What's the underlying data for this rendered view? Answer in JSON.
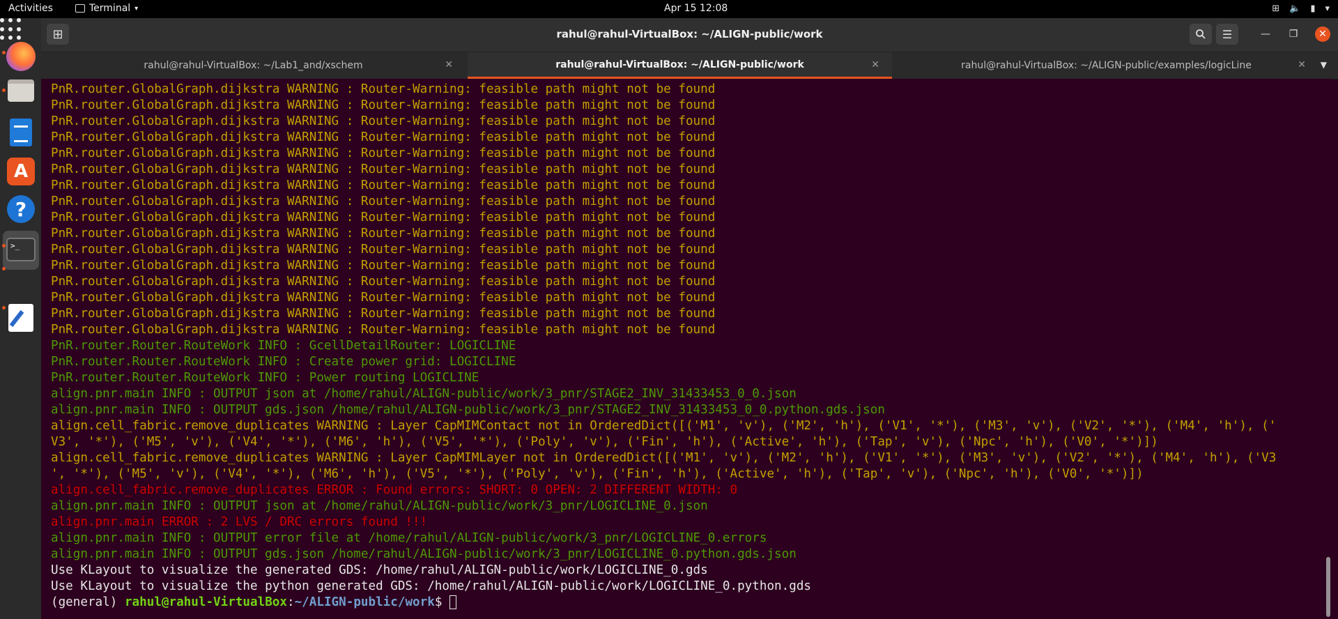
{
  "topbar": {
    "activities": "Activities",
    "app_name": "Terminal",
    "clock": "Apr 15  12:08"
  },
  "window": {
    "title": "rahul@rahul-VirtualBox: ~/ALIGN-public/work"
  },
  "tabs": [
    {
      "label": "rahul@rahul-VirtualBox: ~/Lab1_and/xschem",
      "active": false
    },
    {
      "label": "rahul@rahul-VirtualBox: ~/ALIGN-public/work",
      "active": true
    },
    {
      "label": "rahul@rahul-VirtualBox: ~/ALIGN-public/examples/logicLine",
      "active": false
    }
  ],
  "colors": {
    "accent": "#e95420",
    "terminal_bg": "#2c001e",
    "warning": "#c4a000",
    "info": "#4e9a06",
    "error": "#cc0000"
  },
  "terminal": {
    "lines": [
      {
        "level": "warning",
        "text": "PnR.router.GlobalGraph.dijkstra WARNING : Router-Warning: feasible path might not be found"
      },
      {
        "level": "warning",
        "text": "PnR.router.GlobalGraph.dijkstra WARNING : Router-Warning: feasible path might not be found"
      },
      {
        "level": "warning",
        "text": "PnR.router.GlobalGraph.dijkstra WARNING : Router-Warning: feasible path might not be found"
      },
      {
        "level": "warning",
        "text": "PnR.router.GlobalGraph.dijkstra WARNING : Router-Warning: feasible path might not be found"
      },
      {
        "level": "warning",
        "text": "PnR.router.GlobalGraph.dijkstra WARNING : Router-Warning: feasible path might not be found"
      },
      {
        "level": "warning",
        "text": "PnR.router.GlobalGraph.dijkstra WARNING : Router-Warning: feasible path might not be found"
      },
      {
        "level": "warning",
        "text": "PnR.router.GlobalGraph.dijkstra WARNING : Router-Warning: feasible path might not be found"
      },
      {
        "level": "warning",
        "text": "PnR.router.GlobalGraph.dijkstra WARNING : Router-Warning: feasible path might not be found"
      },
      {
        "level": "warning",
        "text": "PnR.router.GlobalGraph.dijkstra WARNING : Router-Warning: feasible path might not be found"
      },
      {
        "level": "warning",
        "text": "PnR.router.GlobalGraph.dijkstra WARNING : Router-Warning: feasible path might not be found"
      },
      {
        "level": "warning",
        "text": "PnR.router.GlobalGraph.dijkstra WARNING : Router-Warning: feasible path might not be found"
      },
      {
        "level": "warning",
        "text": "PnR.router.GlobalGraph.dijkstra WARNING : Router-Warning: feasible path might not be found"
      },
      {
        "level": "warning",
        "text": "PnR.router.GlobalGraph.dijkstra WARNING : Router-Warning: feasible path might not be found"
      },
      {
        "level": "warning",
        "text": "PnR.router.GlobalGraph.dijkstra WARNING : Router-Warning: feasible path might not be found"
      },
      {
        "level": "warning",
        "text": "PnR.router.GlobalGraph.dijkstra WARNING : Router-Warning: feasible path might not be found"
      },
      {
        "level": "warning",
        "text": "PnR.router.GlobalGraph.dijkstra WARNING : Router-Warning: feasible path might not be found"
      },
      {
        "level": "info",
        "text": "PnR.router.Router.RouteWork INFO : GcellDetailRouter: LOGICLINE"
      },
      {
        "level": "info",
        "text": "PnR.router.Router.RouteWork INFO : Create power grid: LOGICLINE"
      },
      {
        "level": "info",
        "text": "PnR.router.Router.RouteWork INFO : Power routing LOGICLINE"
      },
      {
        "level": "info",
        "text": "align.pnr.main INFO : OUTPUT json at /home/rahul/ALIGN-public/work/3_pnr/STAGE2_INV_31433453_0_0.json"
      },
      {
        "level": "info",
        "text": "align.pnr.main INFO : OUTPUT gds.json /home/rahul/ALIGN-public/work/3_pnr/STAGE2_INV_31433453_0_0.python.gds.json"
      },
      {
        "level": "warning",
        "text": "align.cell_fabric.remove_duplicates WARNING : Layer CapMIMContact not in OrderedDict([('M1', 'v'), ('M2', 'h'), ('V1', '*'), ('M3', 'v'), ('V2', '*'), ('M4', 'h'), ('"
      },
      {
        "level": "warning",
        "text": "V3', '*'), ('M5', 'v'), ('V4', '*'), ('M6', 'h'), ('V5', '*'), ('Poly', 'v'), ('Fin', 'h'), ('Active', 'h'), ('Tap', 'v'), ('Npc', 'h'), ('V0', '*')])"
      },
      {
        "level": "warning",
        "text": "align.cell_fabric.remove_duplicates WARNING : Layer CapMIMLayer not in OrderedDict([('M1', 'v'), ('M2', 'h'), ('V1', '*'), ('M3', 'v'), ('V2', '*'), ('M4', 'h'), ('V3"
      },
      {
        "level": "warning",
        "text": "', '*'), ('M5', 'v'), ('V4', '*'), ('M6', 'h'), ('V5', '*'), ('Poly', 'v'), ('Fin', 'h'), ('Active', 'h'), ('Tap', 'v'), ('Npc', 'h'), ('V0', '*')])"
      },
      {
        "level": "error",
        "text": "align.cell_fabric.remove_duplicates ERROR : Found errors: SHORT: 0 OPEN: 2 DIFFERENT WIDTH: 0"
      },
      {
        "level": "info",
        "text": "align.pnr.main INFO : OUTPUT json at /home/rahul/ALIGN-public/work/3_pnr/LOGICLINE_0.json"
      },
      {
        "level": "error",
        "text": "align.pnr.main ERROR : 2 LVS / DRC errors found !!!"
      },
      {
        "level": "info",
        "text": "align.pnr.main INFO : OUTPUT error file at /home/rahul/ALIGN-public/work/3_pnr/LOGICLINE_0.errors"
      },
      {
        "level": "info",
        "text": "align.pnr.main INFO : OUTPUT gds.json /home/rahul/ALIGN-public/work/3_pnr/LOGICLINE_0.python.gds.json"
      },
      {
        "level": "plain",
        "text": "Use KLayout to visualize the generated GDS: /home/rahul/ALIGN-public/work/LOGICLINE_0.gds"
      },
      {
        "level": "plain",
        "text": "Use KLayout to visualize the python generated GDS: /home/rahul/ALIGN-public/work/LOGICLINE_0.python.gds"
      }
    ],
    "prompt": {
      "env": "(general) ",
      "user_host": "rahul@rahul-VirtualBox",
      "sep": ":",
      "path": "~/ALIGN-public/work",
      "symbol": "$ "
    }
  },
  "icons": {
    "new_tab": "new-tab-icon",
    "search": "search-icon",
    "menu": "hamburger-menu-icon",
    "minimize": "minimize-icon",
    "maximize": "maximize-icon",
    "close": "close-icon"
  }
}
